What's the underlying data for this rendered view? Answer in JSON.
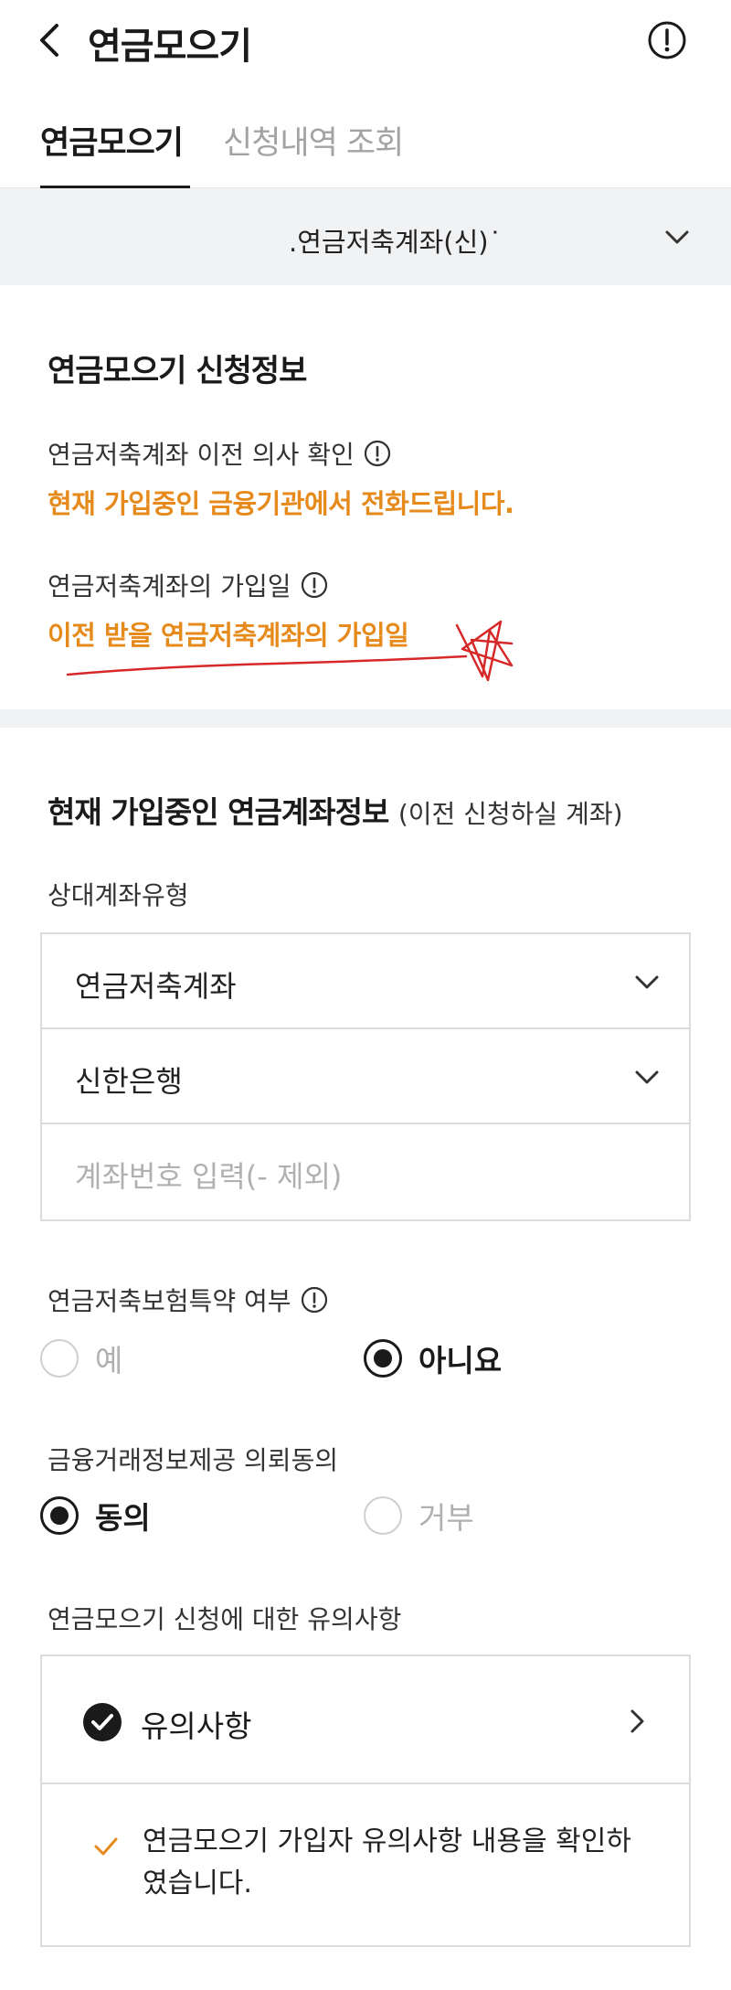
{
  "header": {
    "title": "연금모으기"
  },
  "tabs": [
    {
      "label": "연금모으기",
      "active": true
    },
    {
      "label": "신청내역 조회",
      "active": false
    }
  ],
  "account_select": {
    "value": ".연금저축계좌(신)˙"
  },
  "section1": {
    "title": "연금모으기 신청정보",
    "transfer_confirm_label": "연금저축계좌 이전 의사 확인",
    "transfer_confirm_value": "현재 가입중인 금융기관에서 전화드립니다.",
    "join_date_label": "연금저축계좌의 가입일",
    "join_date_value": "이전 받을 연금저축계좌의 가입일"
  },
  "section2": {
    "title": "현재 가입중인 연금계좌정보",
    "title_sub": "(이전 신청하실 계좌)",
    "account_type_label": "상대계좌유형",
    "account_type_value": "연금저축계좌",
    "bank_value": "신한은행",
    "account_number_placeholder": "계좌번호 입력(- 제외)",
    "insurance_label": "연금저축보험특약 여부",
    "insurance_options": [
      {
        "label": "예",
        "checked": false
      },
      {
        "label": "아니요",
        "checked": true
      }
    ],
    "consent_label": "금융거래정보제공 의뢰동의",
    "consent_options": [
      {
        "label": "동의",
        "checked": true
      },
      {
        "label": "거부",
        "checked": false
      }
    ],
    "notice_label": "연금모으기 신청에 대한 유의사항",
    "notice_header": "유의사항",
    "notice_body": "연금모으기 가입자 유의사항 내용을 확인하였습니다."
  },
  "colors": {
    "accent_orange": "#e68a1c",
    "dark": "#1a1a1a",
    "band_gray": "#f1f2f4",
    "scribble_red": "#d62828"
  },
  "icons": {
    "back": "chevron-left-icon",
    "info": "info-circle-icon",
    "dropdown": "chevron-down-icon",
    "forward": "chevron-right-icon",
    "check_circle": "check-circle-icon",
    "check": "check-icon"
  }
}
